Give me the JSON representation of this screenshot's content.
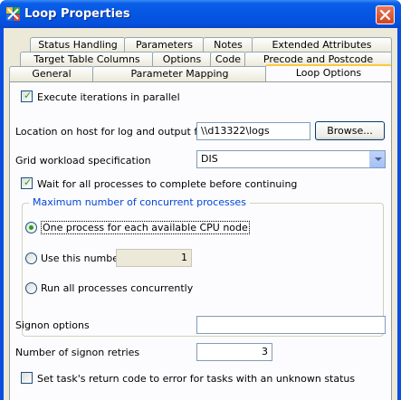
{
  "window": {
    "title": "Loop Properties"
  },
  "tabs": {
    "row1": [
      "Status Handling",
      "Parameters",
      "Notes",
      "Extended Attributes"
    ],
    "row2": [
      "Target Table Columns",
      "Options",
      "Code",
      "Precode and Postcode"
    ],
    "row3": [
      "General",
      "Parameter Mapping",
      "Loop Options"
    ],
    "active": "Loop Options"
  },
  "loop_options": {
    "execute_parallel": {
      "label": "Execute iterations in parallel",
      "checked": true
    },
    "location": {
      "label": "Location on host for log and output files",
      "value": "\\\\d13322\\logs",
      "browse_label": "Browse..."
    },
    "grid_workload": {
      "label": "Grid workload specification",
      "value": "DIS"
    },
    "wait_all": {
      "label": "Wait for all processes to complete before continuing",
      "checked": true
    },
    "max_concurrent": {
      "title": "Maximum number of concurrent processes",
      "options": [
        "One process for each available CPU node",
        "Use this number",
        "Run all processes concurrently"
      ],
      "selected": "One process for each available CPU node",
      "use_number_value": "1"
    },
    "signon_options": {
      "label": "Signon options",
      "value": ""
    },
    "signon_retries": {
      "label": "Number of signon retries",
      "value": "3"
    },
    "set_return_code": {
      "label": "Set task's return code to error for tasks with an unknown status",
      "checked": false
    }
  },
  "colors": {
    "title_bar": "#0556e4",
    "client_bg": "#ece9d8",
    "active_tab_accent": "#ffc83c",
    "check_green": "#21a121",
    "group_title": "#0046d5"
  },
  "icons": {
    "app": "loop-app-icon",
    "close": "close-icon",
    "dropdown": "chevron-down-icon"
  }
}
